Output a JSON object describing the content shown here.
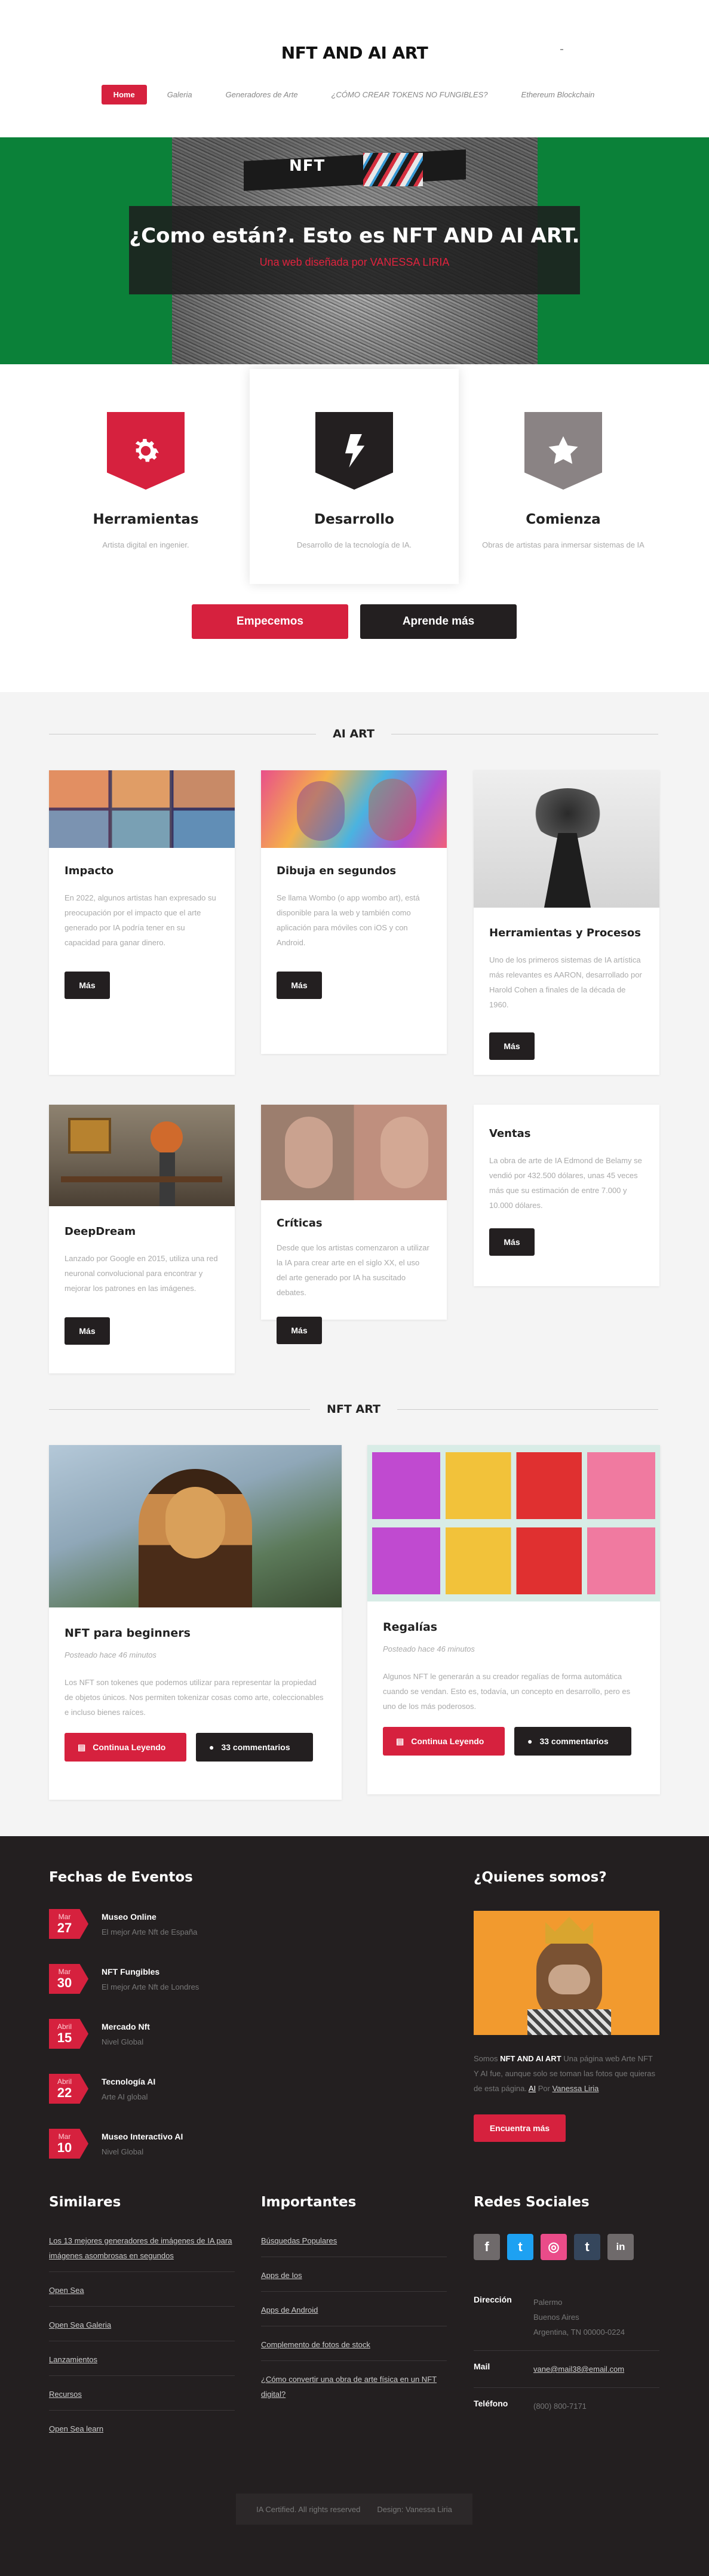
{
  "header": {
    "site_title": "NFT AND AI ART",
    "nav": [
      "Home",
      "Galeria",
      "Generadores de Arte",
      "¿CÓMO CREAR TOKENS NO FUNGIBLES?",
      "Ethereum Blockchain"
    ]
  },
  "hero": {
    "logo_text": "NFT",
    "heading": "¿Como están?. Esto es NFT AND AI ART.",
    "subheading": "Una web diseñada por VANESSA LIRIA"
  },
  "features": [
    {
      "icon": "gear-icon",
      "title": "Herramientas",
      "text": "Artista digital en ingenier.",
      "color": "#d6213e"
    },
    {
      "icon": "lightning-icon",
      "title": "Desarrollo",
      "text": "Desarrollo de la tecnología de IA.",
      "color": "#231f20"
    },
    {
      "icon": "star-icon",
      "title": "Comienza",
      "text": "Obras de artistas para inmersar sistemas de IA",
      "color": "#8a8384"
    }
  ],
  "cta": {
    "start": "Empecemos",
    "learn": "Aprende más"
  },
  "ai_art": {
    "title": "AI ART",
    "cards": [
      {
        "title": "Impacto",
        "text": "En 2022, algunos artistas han expresado su preocupación por el impacto que el arte generado por IA podría tener en su capacidad para ganar dinero.",
        "button": "Más"
      },
      {
        "title": "Dibuja en segundos",
        "text": "Se llama Wombo (o app wombo art), está disponible para la web y también como aplicación para móviles con iOS y con Android.",
        "button": "Más"
      },
      {
        "title": "Herramientas y Procesos",
        "text": "Uno de los primeros sistemas de IA artística más relevantes es AARON, desarrollado por Harold Cohen a finales de la década de 1960.",
        "button": "Más"
      },
      {
        "title": "DeepDream",
        "text": "Lanzado por Google en 2015, utiliza una red neuronal convolucional para encontrar y mejorar los patrones en las imágenes.",
        "button": "Más"
      },
      {
        "title": "Críticas",
        "text": "Desde que los artistas comenzaron a utilizar la IA para crear arte en el siglo XX, el uso del arte generado por IA ha suscitado debates.",
        "button": "Más"
      },
      {
        "title": "Ventas",
        "text": "La obra de arte de IA Edmond de Belamy se vendió por 432.500 dólares, unas 45 veces más que su estimación de entre 7.000 y 10.000 dólares.",
        "button": "Más"
      }
    ]
  },
  "nft_art": {
    "title": "NFT ART",
    "posts": [
      {
        "title": "NFT para beginners",
        "posted": "Posteado hace 46 minutos",
        "excerpt": "Los NFT son tokenes que podemos utilizar para representar la propiedad de objetos únicos. Nos permiten tokenizar cosas como arte, coleccionables e incluso bienes raíces.",
        "continue": "Continua Leyendo",
        "comments": "33 commentarios"
      },
      {
        "title": "Regalías",
        "posted": "Posteado hace 46 minutos",
        "excerpt": "Algunos NFT le generarán a su creador regalías de forma automática cuando se vendan. Esto es, todavía, un concepto en desarrollo, pero es uno de los más poderosos.",
        "continue": "Continua Leyendo",
        "comments": "33 commentarios"
      }
    ]
  },
  "footer": {
    "events_title": "Fechas de Eventos",
    "events": [
      {
        "month": "Mar",
        "day": "27",
        "title": "Museo Online",
        "subtitle": "El mejor Arte Nft de España"
      },
      {
        "month": "Mar",
        "day": "30",
        "title": "NFT Fungibles",
        "subtitle": "El mejor Arte Nft de Londres"
      },
      {
        "month": "Abril",
        "day": "15",
        "title": "Mercado Nft",
        "subtitle": "Nivel Global"
      },
      {
        "month": "Abril",
        "day": "22",
        "title": "Tecnología AI",
        "subtitle": "Arte AI global"
      },
      {
        "month": "Mar",
        "day": "10",
        "title": "Museo Interactivo AI",
        "subtitle": "Nivel Global"
      }
    ],
    "about_title": "¿Quienes somos?",
    "about": {
      "p1": "Somos",
      "brand": "NFT AND AI ART",
      "p2": "Una página web Arte NFT Y AI fue, aunque solo se toman las fotos que quieras de esta página.",
      "ai_link": "AI",
      "p3": "Por",
      "author": "Vanessa Liria"
    },
    "about_button": "Encuentra más",
    "similares_title": "Similares",
    "similares": [
      "Los 13 mejores generadores de imágenes de IA para imágenes asombrosas en segundos",
      "Open Sea",
      "Open Sea Galeria",
      "Lanzamientos",
      "Recursos",
      "Open Sea learn"
    ],
    "importantes_title": "Importantes",
    "importantes": [
      "Búsquedas Populares",
      "Apps de Ios",
      "Apps de Android",
      "Complemento de fotos de stock",
      "¿Cómo convertir una obra de arte física en un NFT digital?"
    ],
    "social_title": "Redes Sociales",
    "social": [
      {
        "icon": "facebook-icon",
        "glyph": "f",
        "color": "#6f6a6b"
      },
      {
        "icon": "twitter-icon",
        "glyph": "t",
        "color": "#1da1f2"
      },
      {
        "icon": "dribbble-icon",
        "glyph": "◎",
        "color": "#ea4c89"
      },
      {
        "icon": "tumblr-icon",
        "glyph": "t",
        "color": "#35465c"
      },
      {
        "icon": "linkedin-icon",
        "glyph": "in",
        "color": "#6f6a6b"
      }
    ],
    "contact": [
      {
        "label": "Dirección",
        "value": "Palermo\nBuenos Aires\nArgentina, TN 00000-0224"
      },
      {
        "label": "Mail",
        "value": "vane@mail38@email.com"
      },
      {
        "label": "Teléfono",
        "value": "(800) 800-7171"
      }
    ],
    "copyright": "IA Certified. All rights reserved",
    "design": "Design: Vanessa Liria"
  }
}
